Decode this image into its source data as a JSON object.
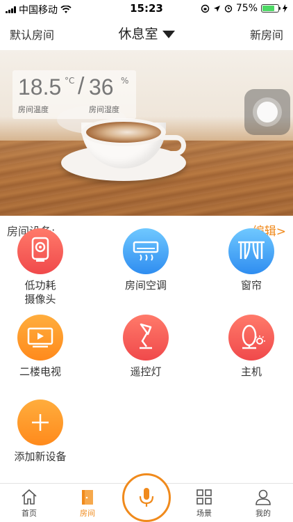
{
  "status_bar": {
    "carrier": "中国移动",
    "time": "15:23",
    "battery_percent": "75%",
    "battery_level": 0.75
  },
  "nav": {
    "left": "默认房间",
    "title": "休息室",
    "right": "新房间"
  },
  "climate": {
    "temperature": "18.5",
    "temperature_unit": "°C",
    "humidity": "36",
    "humidity_unit": "%",
    "separator": "/",
    "temperature_label": "房间温度",
    "humidity_label": "房间湿度"
  },
  "devices_section": {
    "title": "房间设备:",
    "edit": "编辑>"
  },
  "devices": [
    {
      "label": "低功耗\n摄像头",
      "icon": "camera-icon",
      "color": "#f25b55"
    },
    {
      "label": "房间空调",
      "icon": "air-conditioner-icon",
      "color": "#3d9af2"
    },
    {
      "label": "窗帘",
      "icon": "curtain-icon",
      "color": "#3d9af2"
    },
    {
      "label": "二楼电视",
      "icon": "tv-icon",
      "color": "#ff9a2a"
    },
    {
      "label": "遥控灯",
      "icon": "lamp-icon",
      "color": "#f25b55"
    },
    {
      "label": "主机",
      "icon": "host-icon",
      "color": "#f25b55"
    },
    {
      "label": "添加新设备",
      "icon": "plus-icon",
      "color": "#ff9a2a"
    }
  ],
  "tabs": [
    {
      "label": "首页",
      "icon": "home-icon",
      "active": false
    },
    {
      "label": "房间",
      "icon": "door-icon",
      "active": true
    },
    {
      "label": "场景",
      "icon": "grid-icon",
      "active": false
    },
    {
      "label": "我的",
      "icon": "user-icon",
      "active": false
    }
  ],
  "colors": {
    "accent": "#f08a1c",
    "red": "#f25b55",
    "blue": "#3d9af2",
    "orange": "#ff9a2a"
  }
}
